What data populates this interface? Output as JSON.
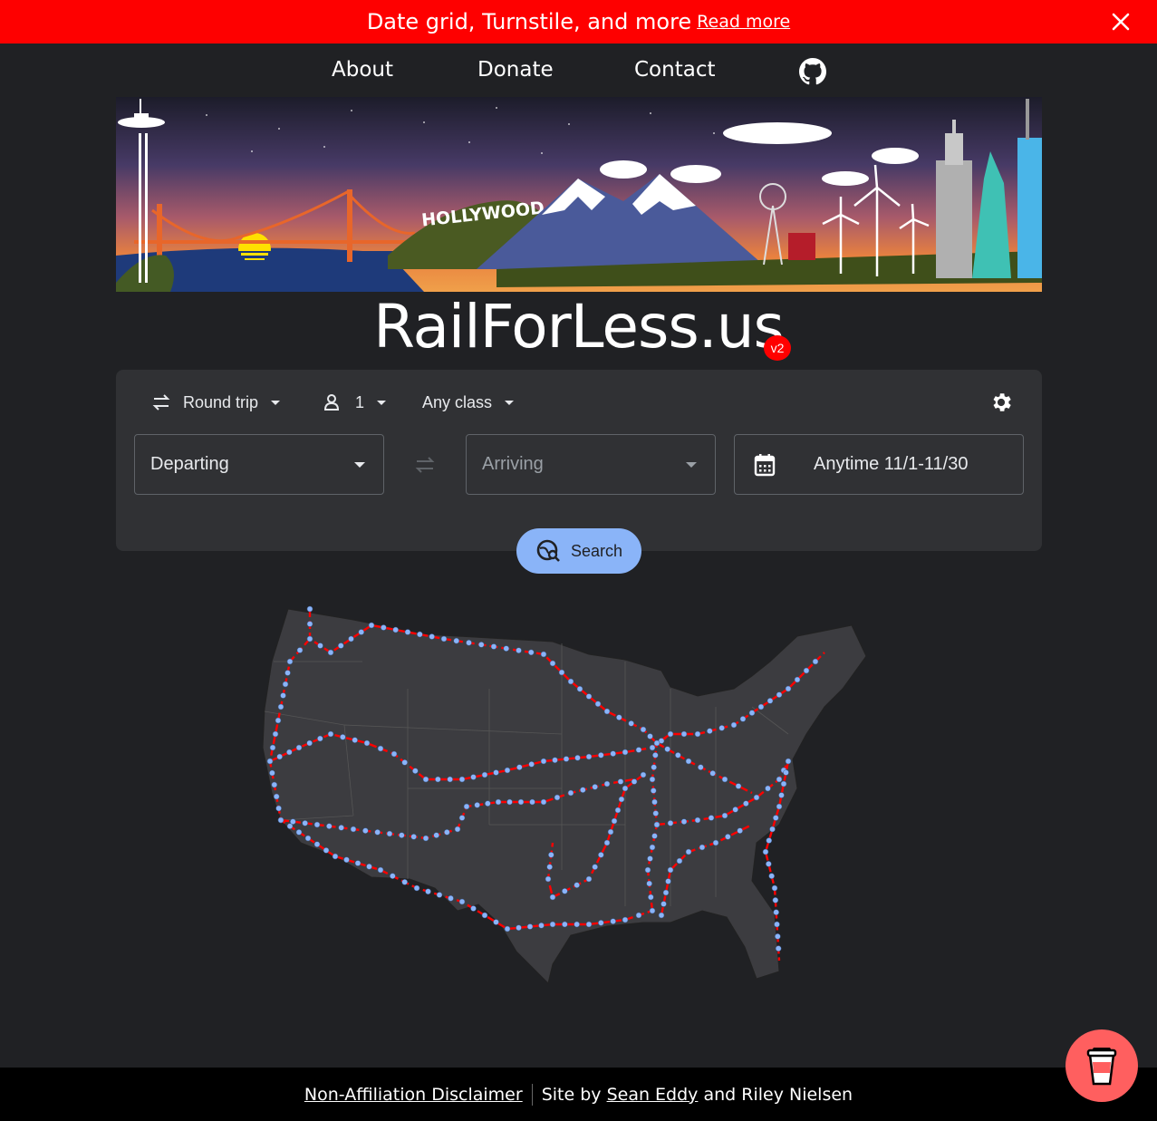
{
  "banner": {
    "message": "Date grid, Turnstile, and more",
    "link": "Read more"
  },
  "nav": {
    "items": [
      "About",
      "Donate",
      "Contact"
    ]
  },
  "hero": {
    "sign": "HOLLYWOOD"
  },
  "site": {
    "title": "RailForLess.us",
    "version": "v2"
  },
  "search": {
    "trip_type": "Round trip",
    "passengers": "1",
    "class": "Any class",
    "departing": "Departing",
    "arriving": "Arriving",
    "dates": "Anytime 11/1-11/30",
    "button": "Search"
  },
  "footer": {
    "disclaimer": "Non-Affiliation Disclaimer",
    "site_by": "Site by",
    "author1": "Sean Eddy",
    "and": "and",
    "author2": "Riley Nielsen"
  },
  "colors": {
    "banner": "#fe0000",
    "accent": "#8ab4f8",
    "route": "#ff0000",
    "panel": "#303134",
    "bg": "#202124",
    "coffee": "#ff5f5f"
  },
  "icons": [
    "close-icon",
    "github-icon",
    "swap-icon",
    "person-icon",
    "settings-icon",
    "calendar-icon",
    "search-icon",
    "coffee-cup-icon"
  ]
}
